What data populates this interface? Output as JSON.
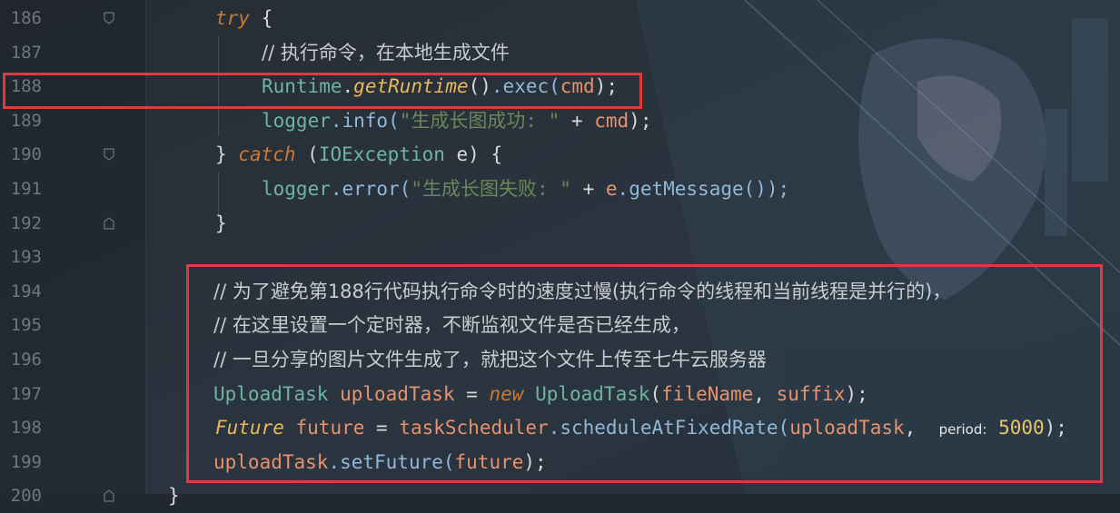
{
  "editor": {
    "lines": [
      {
        "number": "186",
        "tokens": [
          {
            "t": "try",
            "c": "kw"
          },
          {
            "t": " {",
            "c": "op"
          }
        ]
      },
      {
        "number": "187",
        "tokens": [
          {
            "t": "// 执行命令，在本地生成文件",
            "c": "cm"
          }
        ]
      },
      {
        "number": "188",
        "tokens": [
          {
            "t": "Runtime",
            "c": "ty"
          },
          {
            "t": ".",
            "c": "op"
          },
          {
            "t": "getRuntime",
            "c": "fn"
          },
          {
            "t": "()",
            "c": "op"
          },
          {
            "t": ".exec(",
            "c": "mt"
          },
          {
            "t": "cmd",
            "c": "vr"
          },
          {
            "t": ");",
            "c": "op"
          }
        ]
      },
      {
        "number": "189",
        "tokens": [
          {
            "t": "logger",
            "c": "ty"
          },
          {
            "t": ".info(",
            "c": "mt"
          },
          {
            "t": "\"生成长图成功: \"",
            "c": "st"
          },
          {
            "t": " + ",
            "c": "op"
          },
          {
            "t": "cmd",
            "c": "vr"
          },
          {
            "t": ");",
            "c": "op"
          }
        ]
      },
      {
        "number": "190",
        "tokens": [
          {
            "t": "} ",
            "c": "op"
          },
          {
            "t": "catch",
            "c": "kw"
          },
          {
            "t": " (",
            "c": "op"
          },
          {
            "t": "IOException",
            "c": "ty"
          },
          {
            "t": " e) {",
            "c": "op"
          }
        ]
      },
      {
        "number": "191",
        "tokens": [
          {
            "t": "logger",
            "c": "ty"
          },
          {
            "t": ".error(",
            "c": "mt"
          },
          {
            "t": "\"生成长图失败: \"",
            "c": "st"
          },
          {
            "t": " + ",
            "c": "op"
          },
          {
            "t": "e",
            "c": "vr"
          },
          {
            "t": ".getMessage());",
            "c": "mt"
          }
        ]
      },
      {
        "number": "192",
        "tokens": [
          {
            "t": "}",
            "c": "op"
          }
        ]
      },
      {
        "number": "193",
        "tokens": []
      },
      {
        "number": "194",
        "tokens": [
          {
            "t": "// 为了避免第188行代码执行命令时的速度过慢(执行命令的线程和当前线程是并行的)，",
            "c": "cm"
          }
        ]
      },
      {
        "number": "195",
        "tokens": [
          {
            "t": "// 在这里设置一个定时器，不断监视文件是否已经生成，",
            "c": "cm"
          }
        ]
      },
      {
        "number": "196",
        "tokens": [
          {
            "t": "// 一旦分享的图片文件生成了，就把这个文件上传至七牛云服务器",
            "c": "cm"
          }
        ]
      },
      {
        "number": "197",
        "tokens": [
          {
            "t": "UploadTask",
            "c": "ty"
          },
          {
            "t": " ",
            "c": "op"
          },
          {
            "t": "uploadTask",
            "c": "vr"
          },
          {
            "t": " = ",
            "c": "op"
          },
          {
            "t": "new",
            "c": "kw"
          },
          {
            "t": " ",
            "c": "op"
          },
          {
            "t": "UploadTask",
            "c": "ty"
          },
          {
            "t": "(",
            "c": "op"
          },
          {
            "t": "fileName",
            "c": "vr"
          },
          {
            "t": ", ",
            "c": "op"
          },
          {
            "t": "suffix",
            "c": "vr"
          },
          {
            "t": ");",
            "c": "op"
          }
        ]
      },
      {
        "number": "198",
        "tokens": [
          {
            "t": "Future",
            "c": "fn"
          },
          {
            "t": " ",
            "c": "op"
          },
          {
            "t": "future",
            "c": "vr"
          },
          {
            "t": " = ",
            "c": "op"
          },
          {
            "t": "taskScheduler",
            "c": "vr"
          },
          {
            "t": ".scheduleAtFixedRate(",
            "c": "mt"
          },
          {
            "t": "uploadTask",
            "c": "vr"
          },
          {
            "t": ",  ",
            "c": "op"
          },
          {
            "t": "period:",
            "c": "hint"
          },
          {
            "t": " 5000",
            "c": "num"
          },
          {
            "t": ");",
            "c": "op"
          }
        ]
      },
      {
        "number": "199",
        "tokens": [
          {
            "t": "uploadTask",
            "c": "vr"
          },
          {
            "t": ".setFuture(",
            "c": "mt"
          },
          {
            "t": "future",
            "c": "vr"
          },
          {
            "t": ");",
            "c": "op"
          }
        ]
      },
      {
        "number": "200",
        "tokens": [
          {
            "t": "}",
            "c": "op"
          }
        ]
      }
    ]
  },
  "colors": {
    "highlight_box": "#e0393e"
  }
}
